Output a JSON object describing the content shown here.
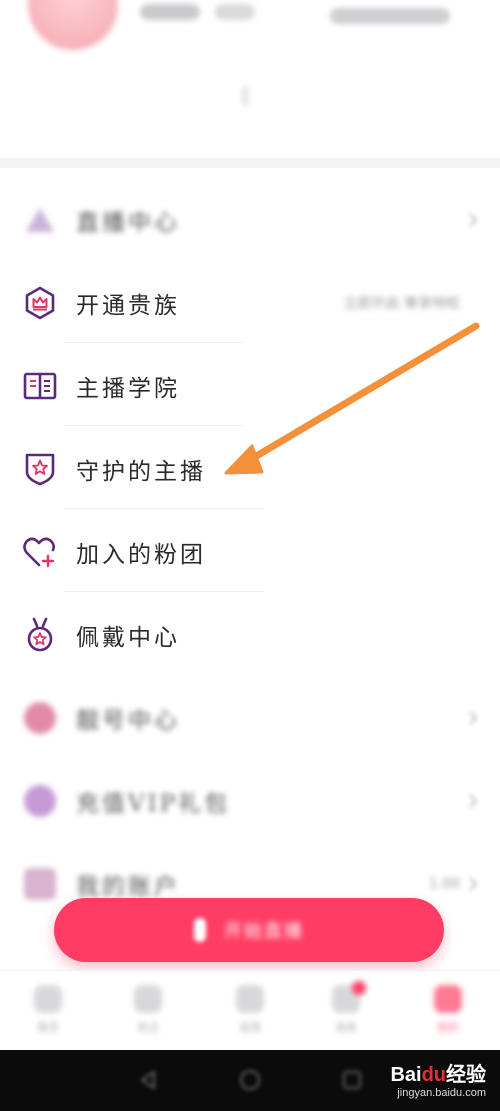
{
  "menu": {
    "items": [
      {
        "label": "直播中心",
        "blurred": true
      },
      {
        "label": "开通贵族",
        "blurred": false,
        "sub": "立即开启 尊享特权"
      },
      {
        "label": "主播学院",
        "blurred": false
      },
      {
        "label": "守护的主播",
        "blurred": false,
        "highlighted": true
      },
      {
        "label": "加入的粉团",
        "blurred": false
      },
      {
        "label": "佩戴中心",
        "blurred": false
      },
      {
        "label": "靓号中心",
        "blurred": true
      },
      {
        "label": "充值VIP礼包",
        "blurred": true
      },
      {
        "label": "我的账户",
        "blurred": true,
        "sub": "1.00"
      }
    ]
  },
  "float_button": {
    "label": "开始直播"
  },
  "tabbar": {
    "tabs": [
      {
        "label": "首页"
      },
      {
        "label": "关注"
      },
      {
        "label": "发现"
      },
      {
        "label": "消息"
      },
      {
        "label": "我的",
        "active": true
      }
    ]
  },
  "watermark": {
    "main_a": "Bai",
    "main_b": "du",
    "main_c": "经验",
    "sub": "jingyan.baidu.com"
  },
  "colors": {
    "accent": "#ff3d64",
    "icon_purple": "#5b2a7a",
    "icon_pink": "#e0356a",
    "arrow": "#f3903a"
  }
}
